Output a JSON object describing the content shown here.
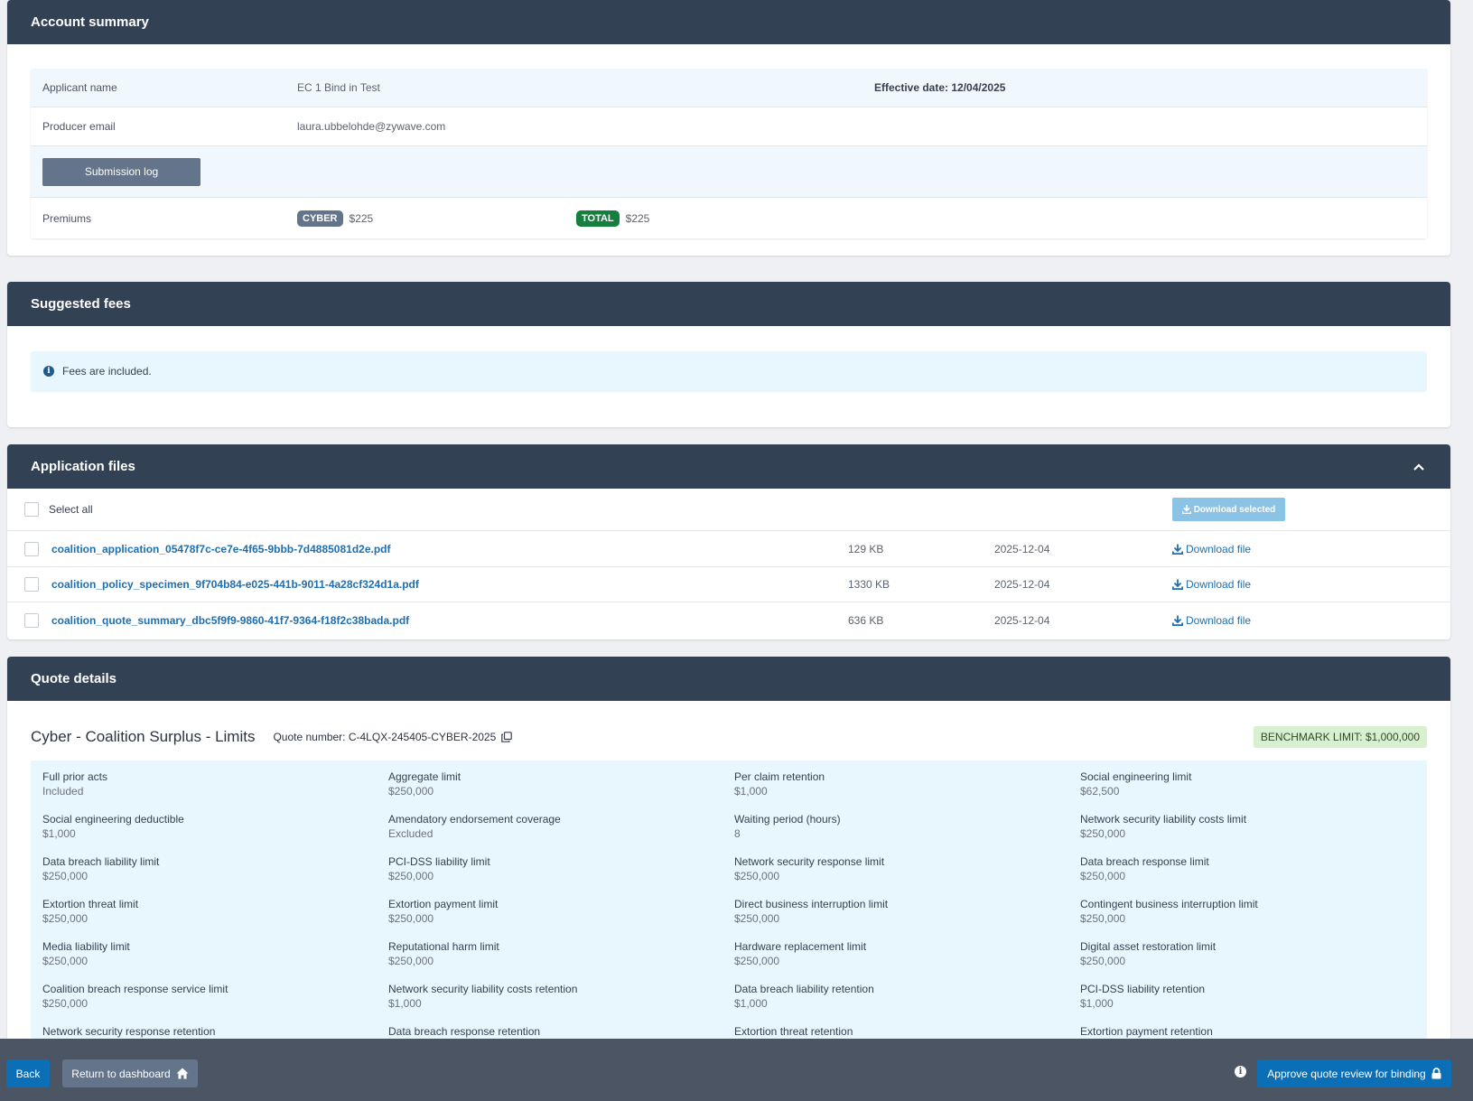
{
  "account_summary": {
    "title": "Account summary",
    "applicant_label": "Applicant name",
    "applicant_value": "EC 1 Bind in Test",
    "effective_date": "Effective date: 12/04/2025",
    "producer_label": "Producer email",
    "producer_value": "laura.ubbelohde@zywave.com",
    "submission_log_button": "Submission log",
    "premiums_label": "Premiums",
    "cyber_badge": "CYBER",
    "cyber_amount": "$225",
    "total_badge": "TOTAL",
    "total_amount": "$225"
  },
  "suggested_fees": {
    "title": "Suggested fees",
    "info_text": "Fees are included."
  },
  "application_files": {
    "title": "Application files",
    "select_all_label": "Select all",
    "download_selected_label": "Download selected",
    "download_file_label": "Download file",
    "files": [
      {
        "name": "coalition_application_05478f7c-ce7e-4f65-9bbb-7d4885081d2e.pdf",
        "size": "129 KB",
        "date": "2025-12-04"
      },
      {
        "name": "coalition_policy_specimen_9f704b84-e025-441b-9011-4a28cf324d1a.pdf",
        "size": "1330 KB",
        "date": "2025-12-04"
      },
      {
        "name": "coalition_quote_summary_dbc5f9f9-9860-41f7-9364-f18f2c38bada.pdf",
        "size": "636 KB",
        "date": "2025-12-04"
      }
    ]
  },
  "quote_details": {
    "title": "Quote details",
    "product_title": "Cyber - Coalition Surplus - Limits",
    "quote_number": "Quote number: C-4LQX-245405-CYBER-2025",
    "benchmark": "BENCHMARK LIMIT: $1,000,000",
    "items": [
      {
        "label": "Full prior acts",
        "value": "Included"
      },
      {
        "label": "Aggregate limit",
        "value": "$250,000"
      },
      {
        "label": "Per claim retention",
        "value": "$1,000"
      },
      {
        "label": "Social engineering limit",
        "value": "$62,500"
      },
      {
        "label": "Social engineering deductible",
        "value": "$1,000"
      },
      {
        "label": "Amendatory endorsement coverage",
        "value": "Excluded"
      },
      {
        "label": "Waiting period (hours)",
        "value": "8"
      },
      {
        "label": "Network security liability costs limit",
        "value": "$250,000"
      },
      {
        "label": "Data breach liability limit",
        "value": "$250,000"
      },
      {
        "label": "PCI-DSS liability limit",
        "value": "$250,000"
      },
      {
        "label": "Network security response limit",
        "value": "$250,000"
      },
      {
        "label": "Data breach response limit",
        "value": "$250,000"
      },
      {
        "label": "Extortion threat limit",
        "value": "$250,000"
      },
      {
        "label": "Extortion payment limit",
        "value": "$250,000"
      },
      {
        "label": "Direct business interruption limit",
        "value": "$250,000"
      },
      {
        "label": "Contingent business interruption limit",
        "value": "$250,000"
      },
      {
        "label": "Media liability limit",
        "value": "$250,000"
      },
      {
        "label": "Reputational harm limit",
        "value": "$250,000"
      },
      {
        "label": "Hardware replacement limit",
        "value": "$250,000"
      },
      {
        "label": "Digital asset restoration limit",
        "value": "$250,000"
      },
      {
        "label": "Coalition breach response service limit",
        "value": "$250,000"
      },
      {
        "label": "Network security liability costs retention",
        "value": "$1,000"
      },
      {
        "label": "Data breach liability retention",
        "value": "$1,000"
      },
      {
        "label": "PCI-DSS liability retention",
        "value": "$1,000"
      },
      {
        "label": "Network security response retention",
        "value": ""
      },
      {
        "label": "Data breach response retention",
        "value": ""
      },
      {
        "label": "Extortion threat retention",
        "value": ""
      },
      {
        "label": "Extortion payment retention",
        "value": ""
      }
    ]
  },
  "footer": {
    "back_label": "Back",
    "dashboard_label": "Return to dashboard",
    "approve_label": "Approve quote review for binding"
  },
  "colors": {
    "header": "#334155",
    "cyber_badge": "#64748b",
    "total_badge": "#15803d",
    "primary_button": "#0b6fb8",
    "link": "#1f6fb0"
  }
}
